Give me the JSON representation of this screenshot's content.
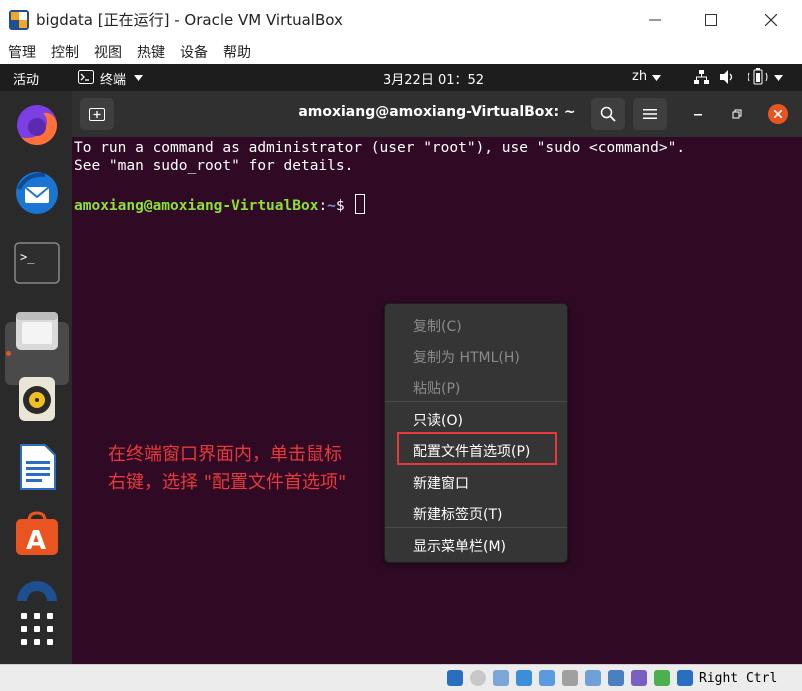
{
  "window": {
    "title": "bigdata [正在运行] - Oracle VM VirtualBox",
    "minimize_icon": "minimize-icon",
    "maximize_icon": "maximize-icon",
    "close_icon": "close-icon"
  },
  "menubar": {
    "items": [
      "管理",
      "控制",
      "视图",
      "热键",
      "设备",
      "帮助"
    ]
  },
  "topbar": {
    "activities": "活动",
    "app_name": "终端",
    "clock": "3月22日  01：52",
    "input_method": "zh",
    "network_icon": "network-icon",
    "volume_icon": "volume-icon",
    "battery_icon": "battery-icon",
    "power_menu_icon": "chevron-down-icon"
  },
  "dock": {
    "apps": [
      "firefox-icon",
      "thunderbird-icon",
      "terminal-icon",
      "files-icon",
      "rhythmbox-icon",
      "libreoffice-writer-icon",
      "ubuntu-software-icon",
      "help-icon",
      "show-apps-icon"
    ]
  },
  "terminal": {
    "title": "amoxiang@amoxiang-VirtualBox: ~",
    "line1": "To run a command as administrator (user \"root\"), use \"sudo <command>\".",
    "line2": "See \"man sudo_root\" for details.",
    "prompt_user": "amoxiang@amoxiang-VirtualBox",
    "prompt_sep": ":",
    "prompt_path": "~",
    "prompt_symbol": "$ "
  },
  "context_menu": {
    "copy": "复制(C)",
    "copy_html": "复制为 HTML(H)",
    "paste": "粘贴(P)",
    "read_only": "只读(O)",
    "preferences": "配置文件首选项(P)",
    "new_window": "新建窗口",
    "new_tab": "新建标签页(T)",
    "show_menubar": "显示菜单栏(M)"
  },
  "annotation": {
    "line1": "在终端窗口界面内，单击鼠标",
    "line2": "右键，选择 \"配置文件首选项\""
  },
  "statusbar": {
    "hostkey": "Right Ctrl"
  },
  "colors": {
    "terminal_bg": "#300a24",
    "prompt_user": "#8ae234",
    "prompt_path": "#729fcf",
    "ubuntu_orange": "#e95420",
    "annotation_red": "#e8383b"
  }
}
